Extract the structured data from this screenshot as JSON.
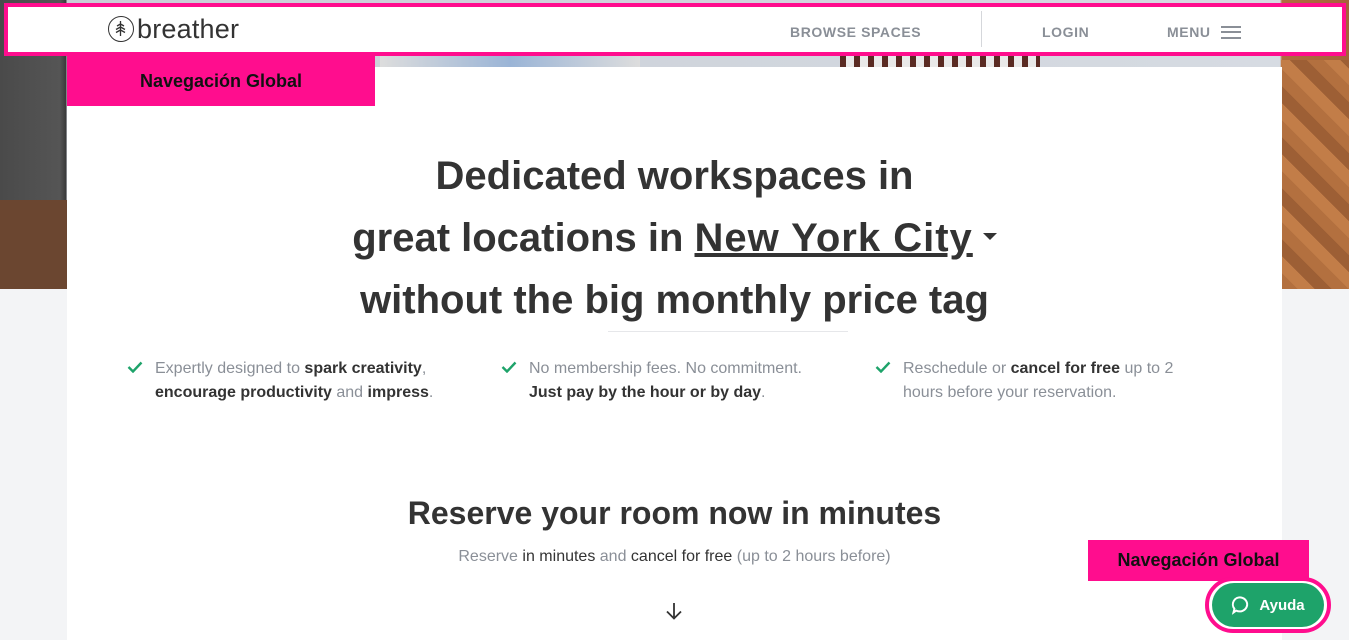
{
  "brand": {
    "name": "breather"
  },
  "nav": {
    "browse": "BROWSE SPACES",
    "login": "LOGIN",
    "menu": "MENU"
  },
  "annotations": {
    "top_tag": "Navegación Global",
    "bottom_tag": "Navegación Global"
  },
  "hero": {
    "line1": "Dedicated workspaces in",
    "line2_prefix": "great locations in",
    "city": "New York City",
    "line3": "without the big monthly price tag"
  },
  "features": [
    {
      "p1": "Expertly designed to ",
      "b1": "spark creativity",
      "p2": ", ",
      "b2": "encourage productivity",
      "p3": " and ",
      "b3": "impress",
      "p4": "."
    },
    {
      "p1": "No membership fees. No commitment. ",
      "b1": "Just pay by the hour or by day",
      "p2": "."
    },
    {
      "p1": "Reschedule or ",
      "b1": "cancel for free",
      "p2": " up to 2 hours before your reservation."
    }
  ],
  "reserve": {
    "title": "Reserve your room now in minutes",
    "sub_a": "Reserve ",
    "sub_b": "in minutes",
    "sub_c": " and ",
    "sub_d": "cancel for free",
    "sub_e": " (up to 2 hours before)"
  },
  "help": {
    "label": "Ayuda"
  },
  "colors": {
    "accent": "#1ea36a",
    "annotation": "#ff0d8e"
  },
  "icons": [
    "tree-logo-icon",
    "hamburger-icon",
    "check-icon",
    "arrow-down-icon",
    "chat-bubble-icon",
    "caret-down-icon"
  ]
}
